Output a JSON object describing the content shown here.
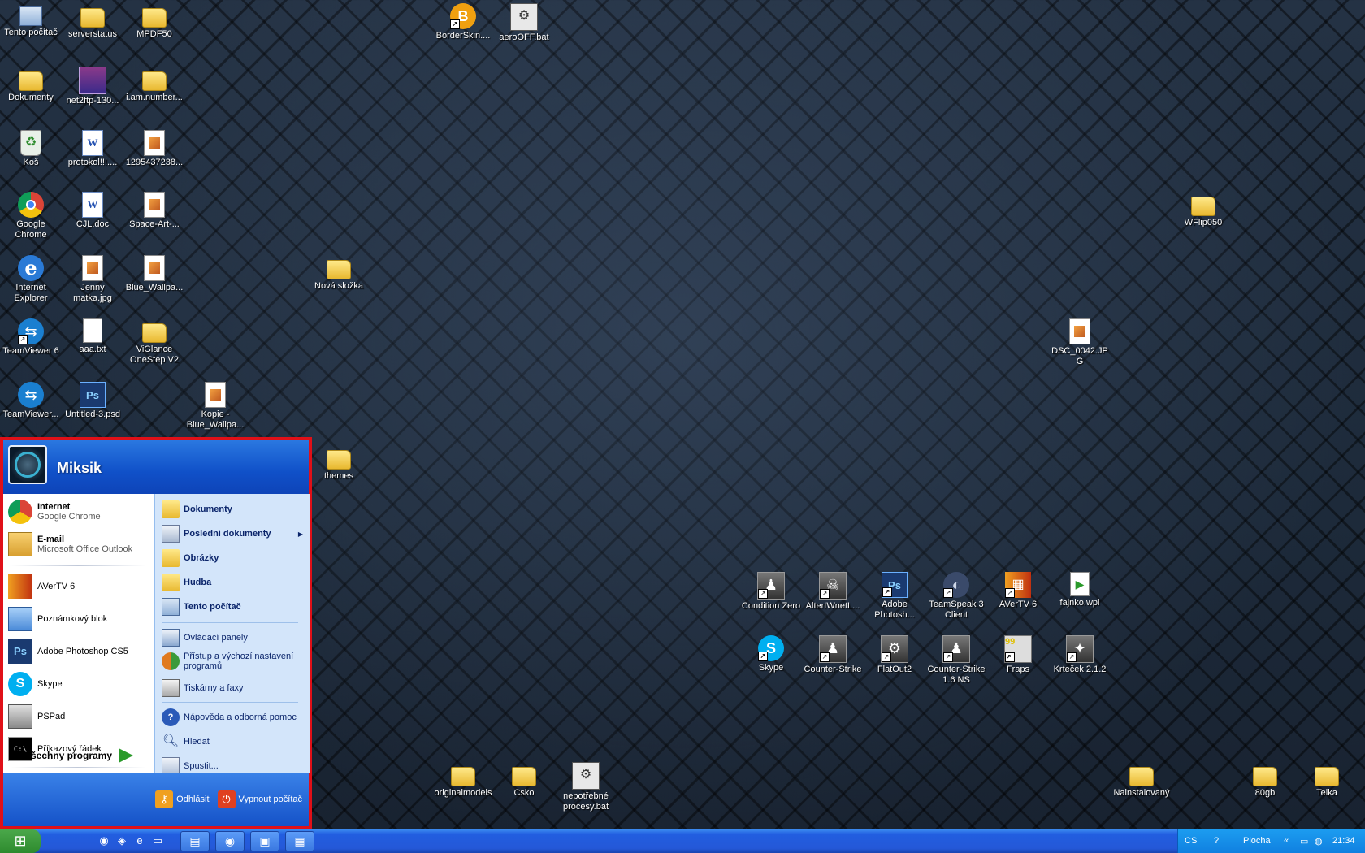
{
  "desktop": {
    "icons": [
      {
        "label": "Tento počítač",
        "icon": "computer-icon"
      },
      {
        "label": "serverstatus",
        "icon": "folder-icon"
      },
      {
        "label": "MPDF50",
        "icon": "folder-icon"
      },
      {
        "label": "BorderSkin....",
        "icon": "borderskin-icon"
      },
      {
        "label": "aeroOFF.bat",
        "icon": "batch-file-icon"
      },
      {
        "label": "Dokumenty",
        "icon": "documents-folder-icon"
      },
      {
        "label": "net2ftp-130...",
        "icon": "archive-icon"
      },
      {
        "label": "i.am.number...",
        "icon": "folder-icon"
      },
      {
        "label": "Koš",
        "icon": "recycle-bin-icon"
      },
      {
        "label": "protokol!!!....",
        "icon": "word-doc-icon"
      },
      {
        "label": "1295437238...",
        "icon": "image-file-icon"
      },
      {
        "label": "Google Chrome",
        "icon": "chrome-icon"
      },
      {
        "label": "CJL.doc",
        "icon": "word-doc-icon"
      },
      {
        "label": "Space-Art-...",
        "icon": "image-file-icon"
      },
      {
        "label": "WFlip050",
        "icon": "folder-icon"
      },
      {
        "label": "Internet Explorer",
        "icon": "ie-icon"
      },
      {
        "label": "Jenny matka.jpg",
        "icon": "image-file-icon"
      },
      {
        "label": "Blue_Wallpa...",
        "icon": "image-file-icon"
      },
      {
        "label": "Nová složka",
        "icon": "folder-icon"
      },
      {
        "label": "TeamViewer 6",
        "icon": "teamviewer-icon"
      },
      {
        "label": "aaa.txt",
        "icon": "text-file-icon"
      },
      {
        "label": "ViGlance OneStep V2",
        "icon": "folder-icon"
      },
      {
        "label": "DSC_0042.JPG",
        "icon": "image-file-icon"
      },
      {
        "label": "TeamViewer...",
        "icon": "teamviewer-icon"
      },
      {
        "label": "Untitled-3.psd",
        "icon": "psd-file-icon"
      },
      {
        "label": "Kopie - Blue_Wallpa...",
        "icon": "image-file-icon"
      },
      {
        "label": "themes",
        "icon": "folder-icon"
      },
      {
        "label": "Condition Zero",
        "icon": "cs-icon"
      },
      {
        "label": "AlterIWnetL...",
        "icon": "game-icon"
      },
      {
        "label": "Adobe Photosh...",
        "icon": "photoshop-icon"
      },
      {
        "label": "TeamSpeak 3 Client",
        "icon": "teamspeak-icon"
      },
      {
        "label": "AVerTV 6",
        "icon": "avertv-icon"
      },
      {
        "label": "fajnko.wpl",
        "icon": "playlist-file-icon"
      },
      {
        "label": "Skype",
        "icon": "skype-icon"
      },
      {
        "label": "Counter-Strike",
        "icon": "cs-icon"
      },
      {
        "label": "FlatOut2",
        "icon": "flatout-icon"
      },
      {
        "label": "Counter-Strike 1.6 NS",
        "icon": "cs-icon"
      },
      {
        "label": "Fraps",
        "icon": "fraps-icon"
      },
      {
        "label": "Krteček 2.1.2",
        "icon": "game-icon"
      },
      {
        "label": "originalmodels",
        "icon": "folder-icon"
      },
      {
        "label": "Csko",
        "icon": "folder-icon"
      },
      {
        "label": "nepotřebné procesy.bat",
        "icon": "batch-file-icon"
      },
      {
        "label": "Nainstalovaný",
        "icon": "folder-icon"
      },
      {
        "label": "80gb",
        "icon": "folder-icon"
      },
      {
        "label": "Telka",
        "icon": "folder-icon"
      }
    ]
  },
  "start_menu": {
    "user": "Miksik",
    "pinned": [
      {
        "title": "Internet",
        "subtitle": "Google Chrome"
      },
      {
        "title": "E-mail",
        "subtitle": "Microsoft Office Outlook"
      }
    ],
    "recent": [
      "AVerTV 6",
      "Poznámkový blok",
      "Adobe Photoshop CS5",
      "Skype",
      "PSPad",
      "Příkazový řádek"
    ],
    "all_programs": "Všechny programy",
    "places": [
      "Dokumenty",
      "Poslední dokumenty",
      "Obrázky",
      "Hudba",
      "Tento počítač"
    ],
    "settings": [
      "Ovládací panely",
      "Přístup a výchozí nastavení programů",
      "Tiskárny a faxy"
    ],
    "help": [
      "Nápověda a odborná pomoc",
      "Hledat",
      "Spustit..."
    ],
    "log_off": "Odhlásit",
    "shut_down": "Vypnout počítač"
  },
  "taskbar": {
    "language": "CS",
    "help_glyph": "?",
    "desktop_label": "Plocha",
    "clock": "21:34"
  },
  "colors": {
    "highlight_border": "#e01018",
    "start_menu_blue": "#1552c8",
    "taskbar_blue": "#2458d8"
  }
}
